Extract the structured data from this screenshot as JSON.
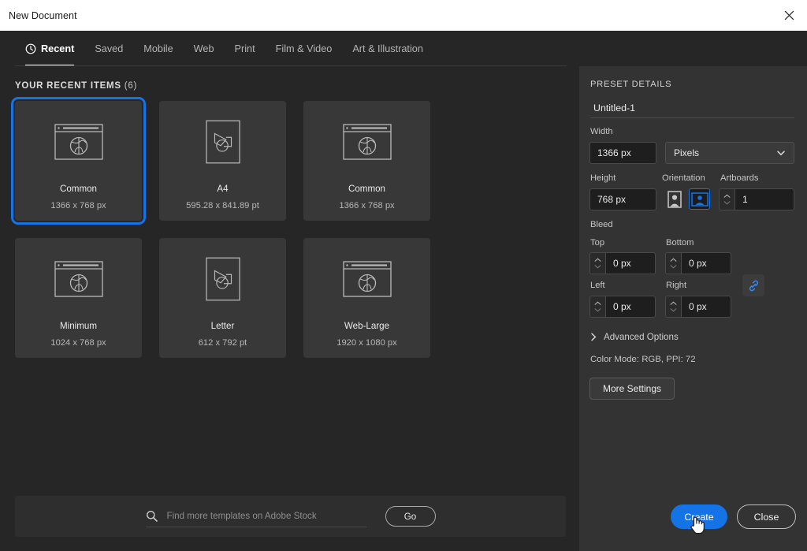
{
  "window": {
    "title": "New Document",
    "close_icon": "close-icon"
  },
  "tabs": [
    {
      "label": "Recent",
      "icon": "clock-icon",
      "active": true
    },
    {
      "label": "Saved",
      "active": false
    },
    {
      "label": "Mobile",
      "active": false
    },
    {
      "label": "Web",
      "active": false
    },
    {
      "label": "Print",
      "active": false
    },
    {
      "label": "Film & Video",
      "active": false
    },
    {
      "label": "Art & Illustration",
      "active": false
    }
  ],
  "recent": {
    "heading": "YOUR RECENT ITEMS",
    "count": "(6)",
    "items": [
      {
        "title": "Common",
        "size": "1366 x 768 px",
        "icon": "browser-window-icon",
        "selected": true
      },
      {
        "title": "A4",
        "size": "595.28 x 841.89 pt",
        "icon": "print-document-icon",
        "selected": false
      },
      {
        "title": "Common",
        "size": "1366 x 768 px",
        "icon": "browser-window-icon",
        "selected": false
      },
      {
        "title": "Minimum",
        "size": "1024 x 768 px",
        "icon": "browser-window-icon",
        "selected": false
      },
      {
        "title": "Letter",
        "size": "612 x 792 pt",
        "icon": "print-document-icon",
        "selected": false
      },
      {
        "title": "Web-Large",
        "size": "1920 x 1080 px",
        "icon": "browser-window-icon",
        "selected": false
      }
    ]
  },
  "stock": {
    "search_icon": "search-icon",
    "placeholder": "Find more templates on Adobe Stock",
    "value": "",
    "go_label": "Go"
  },
  "preset": {
    "heading": "PRESET DETAILS",
    "name_value": "Untitled-1",
    "name_placeholder": "Untitled-1",
    "width_label": "Width",
    "width_value": "1366 px",
    "units_value": "Pixels",
    "units_icon": "chevron-down-icon",
    "height_label": "Height",
    "height_value": "768 px",
    "orientation_label": "Orientation",
    "orientation_portrait_icon": "portrait-orientation-icon",
    "orientation_landscape_icon": "landscape-orientation-icon",
    "orientation_selected": "landscape",
    "artboards_label": "Artboards",
    "artboards_value": "1",
    "bleed_label": "Bleed",
    "bleed_top_label": "Top",
    "bleed_top_value": "0 px",
    "bleed_bottom_label": "Bottom",
    "bleed_bottom_value": "0 px",
    "bleed_left_label": "Left",
    "bleed_left_value": "0 px",
    "bleed_right_label": "Right",
    "bleed_right_value": "0 px",
    "link_icon": "link-chain-icon",
    "advanced_label": "Advanced Options",
    "advanced_icon": "chevron-right-icon",
    "color_mode_line": "Color Mode: RGB, PPI: 72",
    "more_settings_label": "More Settings"
  },
  "footer": {
    "create_label": "Create",
    "close_label": "Close"
  },
  "colors": {
    "accent_blue": "#1473E6",
    "panel_bg": "#333333",
    "content_bg": "#262626",
    "card_bg": "#383838",
    "titlebar_bg": "#FFFFFF"
  }
}
